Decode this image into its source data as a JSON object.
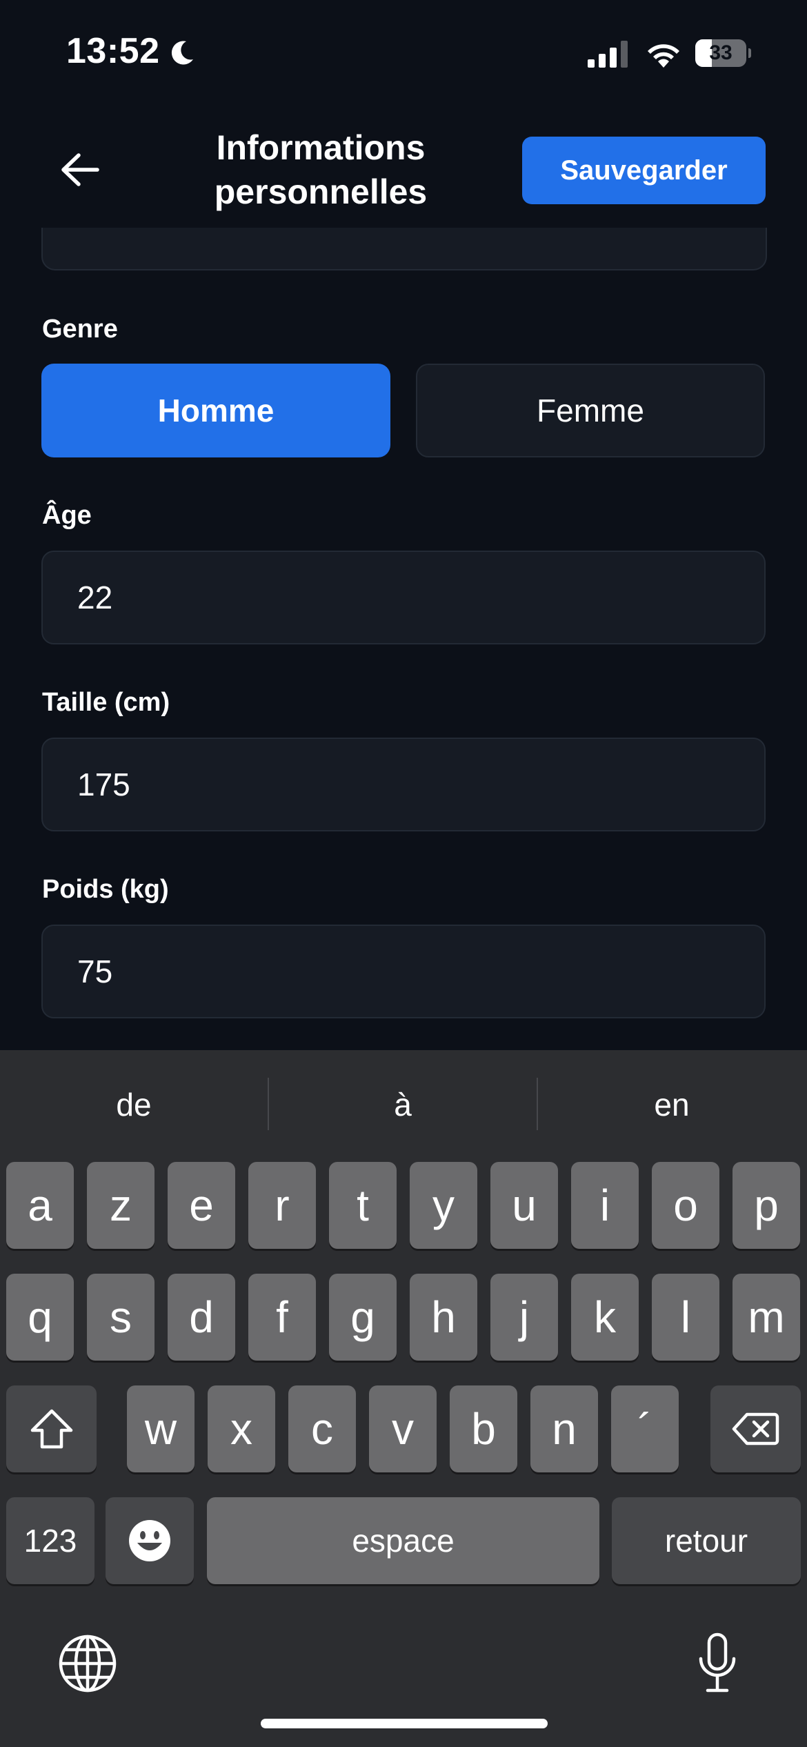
{
  "status_bar": {
    "time": "13:52",
    "battery": "33",
    "battery_level_percent": 33,
    "icons": [
      "moon-icon",
      "signal-icon",
      "wifi-icon",
      "battery-icon"
    ]
  },
  "header": {
    "back_icon": "arrow-left-icon",
    "title": "Informations personnelles",
    "save_label": "Sauvegarder"
  },
  "form": {
    "gender": {
      "label": "Genre",
      "options": [
        "Homme",
        "Femme"
      ],
      "selected": "Homme"
    },
    "age": {
      "label": "Âge",
      "value": "22"
    },
    "height": {
      "label": "Taille (cm)",
      "value": "175"
    },
    "weight": {
      "label": "Poids (kg)",
      "value": "75"
    }
  },
  "keyboard": {
    "suggestions": [
      "de",
      "à",
      "en"
    ],
    "rows": [
      [
        "a",
        "z",
        "e",
        "r",
        "t",
        "y",
        "u",
        "i",
        "o",
        "p"
      ],
      [
        "q",
        "s",
        "d",
        "f",
        "g",
        "h",
        "j",
        "k",
        "l",
        "m"
      ],
      [
        "w",
        "x",
        "c",
        "v",
        "b",
        "n",
        "´"
      ]
    ],
    "numbers_label": "123",
    "space_label": "espace",
    "return_label": "retour",
    "icons": [
      "shift-icon",
      "backspace-icon",
      "emoji-icon",
      "globe-icon",
      "microphone-icon"
    ]
  },
  "colors": {
    "background": "#0c1018",
    "accent": "#2270e8",
    "field_bg": "#161b24",
    "keyboard_bg": "#2c2d30"
  }
}
